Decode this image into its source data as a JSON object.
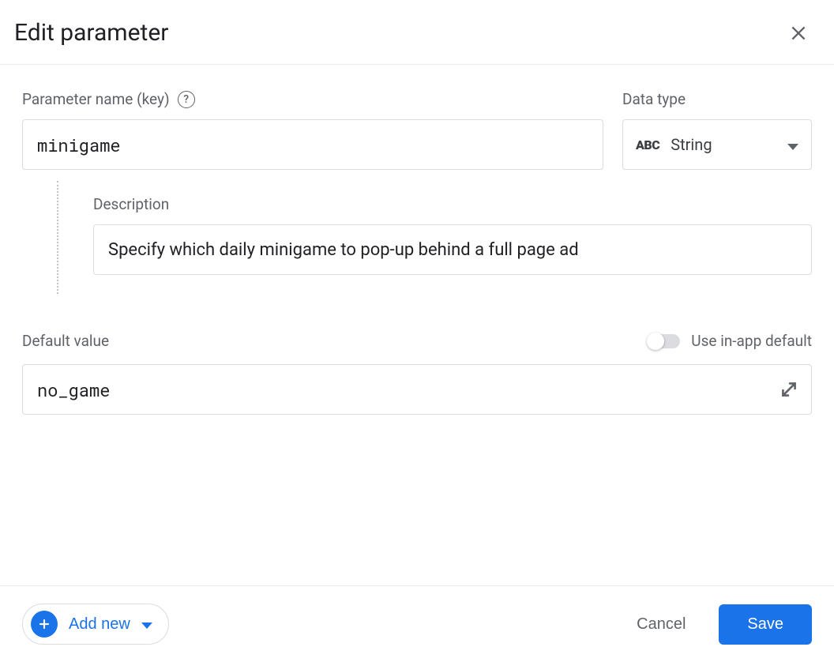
{
  "dialog": {
    "title": "Edit parameter"
  },
  "parameter": {
    "name_label": "Parameter name (key)",
    "name_value": "minigame",
    "data_type_label": "Data type",
    "data_type_value": "String",
    "data_type_icon_text": "ABC"
  },
  "description": {
    "label": "Description",
    "value": "Specify which daily minigame to pop-up behind a full page ad"
  },
  "default_value": {
    "label": "Default value",
    "value": "no_game",
    "toggle_label": "Use in-app default"
  },
  "footer": {
    "add_new_label": "Add new",
    "cancel_label": "Cancel",
    "save_label": "Save"
  }
}
